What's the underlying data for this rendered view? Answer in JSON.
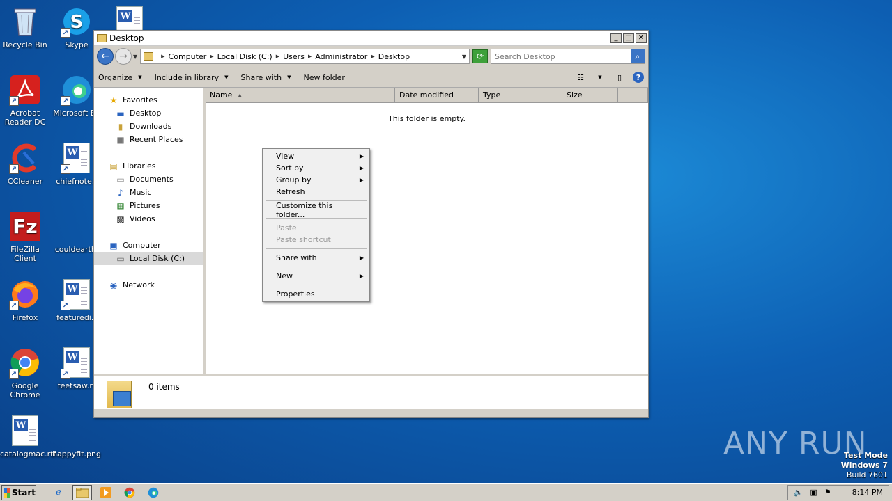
{
  "desktop_icons": [
    {
      "label": "Recycle Bin",
      "icon": "recycle-bin-icon"
    },
    {
      "label": "Skype",
      "icon": "skype-icon"
    },
    {
      "label": "Acrobat Reader DC",
      "icon": "acrobat-icon"
    },
    {
      "label": "Microsoft Ed",
      "icon": "edge-icon"
    },
    {
      "label": "CCleaner",
      "icon": "ccleaner-icon"
    },
    {
      "label": "chiefnote.r",
      "icon": "word-doc-icon"
    },
    {
      "label": "FileZilla Client",
      "icon": "filezilla-icon"
    },
    {
      "label": "couldearth.",
      "icon": "blank-file-icon"
    },
    {
      "label": "Firefox",
      "icon": "firefox-icon"
    },
    {
      "label": "featuredi.r",
      "icon": "word-doc-icon"
    },
    {
      "label": "Google Chrome",
      "icon": "chrome-icon"
    },
    {
      "label": "feetsaw.rt",
      "icon": "word-doc-icon"
    },
    {
      "label": "catalogmac.rtf",
      "icon": "word-doc-icon"
    },
    {
      "label": "happyfit.png",
      "icon": "image-file-icon"
    }
  ],
  "window": {
    "title": "Desktop",
    "breadcrumb": [
      "Computer",
      "Local Disk (C:)",
      "Users",
      "Administrator",
      "Desktop"
    ],
    "search_placeholder": "Search Desktop",
    "toolbar": {
      "organize": "Organize",
      "include_in_library": "Include in library",
      "share_with": "Share with",
      "new_folder": "New folder"
    },
    "nav": {
      "favorites": "Favorites",
      "desktop": "Desktop",
      "downloads": "Downloads",
      "recent_places": "Recent Places",
      "libraries": "Libraries",
      "documents": "Documents",
      "music": "Music",
      "pictures": "Pictures",
      "videos": "Videos",
      "computer": "Computer",
      "local_disk": "Local Disk (C:)",
      "network": "Network"
    },
    "columns": [
      "Name",
      "Date modified",
      "Type",
      "Size"
    ],
    "empty_message": "This folder is empty.",
    "status": "0 items"
  },
  "context_menu": {
    "view": "View",
    "sort_by": "Sort by",
    "group_by": "Group by",
    "refresh": "Refresh",
    "customize": "Customize this folder...",
    "paste": "Paste",
    "paste_shortcut": "Paste shortcut",
    "share_with": "Share with",
    "new": "New",
    "properties": "Properties"
  },
  "taskbar": {
    "start": "Start",
    "time": "8:14 PM"
  },
  "watermark": {
    "text": "ANY RUN",
    "line1": "Test Mode",
    "line2": "Windows 7",
    "line3": "Build 7601"
  }
}
